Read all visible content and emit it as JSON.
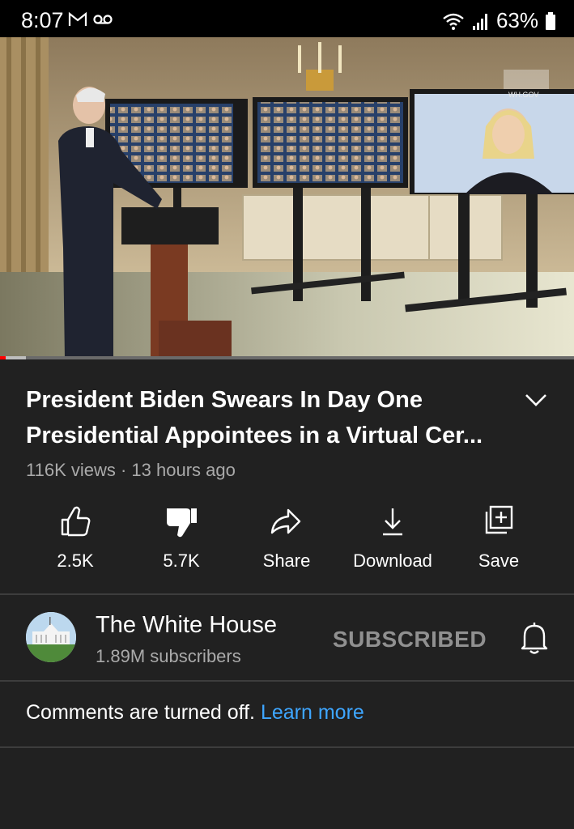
{
  "status_bar": {
    "time": "8:07",
    "left_icons": [
      "gmail-icon",
      "voicemail-icon"
    ],
    "right_icons": [
      "wifi-icon",
      "signal-icon",
      "battery-icon"
    ],
    "battery": "63%"
  },
  "video": {
    "progress_fraction": 0.01,
    "buffered_fraction": 0.045,
    "watermark": "WH.GOV"
  },
  "title": "President Biden Swears In Day One Presidential Appointees in a Virtual Cer...",
  "meta": "116K views · 13 hours ago",
  "actions": {
    "like": "2.5K",
    "dislike": "5.7K",
    "share": "Share",
    "download": "Download",
    "save": "Save"
  },
  "channel": {
    "name": "The White House",
    "subscribers": "1.89M subscribers",
    "subscribe_label": "SUBSCRIBED"
  },
  "comments": {
    "text": "Comments are turned off.",
    "link": "Learn more"
  },
  "colors": {
    "background": "#212121",
    "link": "#3ea6ff",
    "progress": "#ff0000"
  }
}
